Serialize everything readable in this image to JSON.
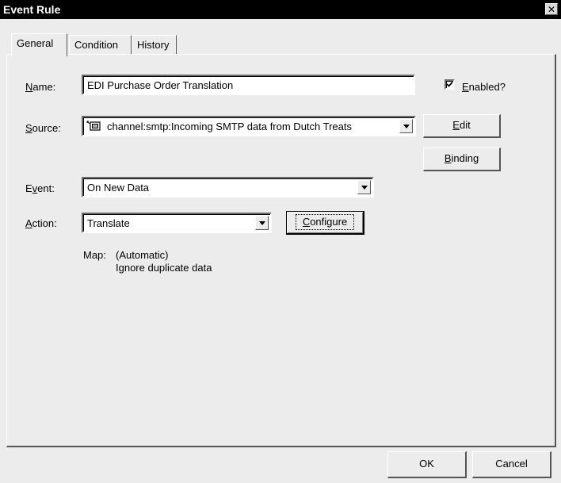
{
  "window": {
    "title": "Event Rule",
    "close_glyph": "✕"
  },
  "tabs": [
    {
      "label": "General",
      "active": true
    },
    {
      "label": "Condition",
      "active": false
    },
    {
      "label": "History",
      "active": false
    }
  ],
  "form": {
    "name": {
      "label_mnemonic": "N",
      "label_rest": "ame:",
      "value": "EDI Purchase Order Translation"
    },
    "enabled": {
      "label_mnemonic": "E",
      "label_rest": "nabled?",
      "checked": true
    },
    "source": {
      "label_mnemonic": "S",
      "label_rest": "ource:",
      "value": "channel:smtp:Incoming SMTP data from Dutch Treats",
      "icon": "channel-icon"
    },
    "edit_button": {
      "mnemonic": "E",
      "rest": "dit"
    },
    "binding_button": {
      "mnemonic": "B",
      "rest": "inding"
    },
    "event": {
      "label_pre": "E",
      "label_mnemonic": "v",
      "label_rest": "ent:",
      "value": "On New Data"
    },
    "action": {
      "label_mnemonic": "A",
      "label_rest": "ction:",
      "value": "Translate"
    },
    "configure_button": {
      "mnemonic": "C",
      "rest": "onfigure"
    },
    "map": {
      "label": "Map:",
      "line1": "(Automatic)",
      "line2": "Ignore duplicate data"
    }
  },
  "footer": {
    "ok_label": "OK",
    "cancel_label": "Cancel"
  }
}
